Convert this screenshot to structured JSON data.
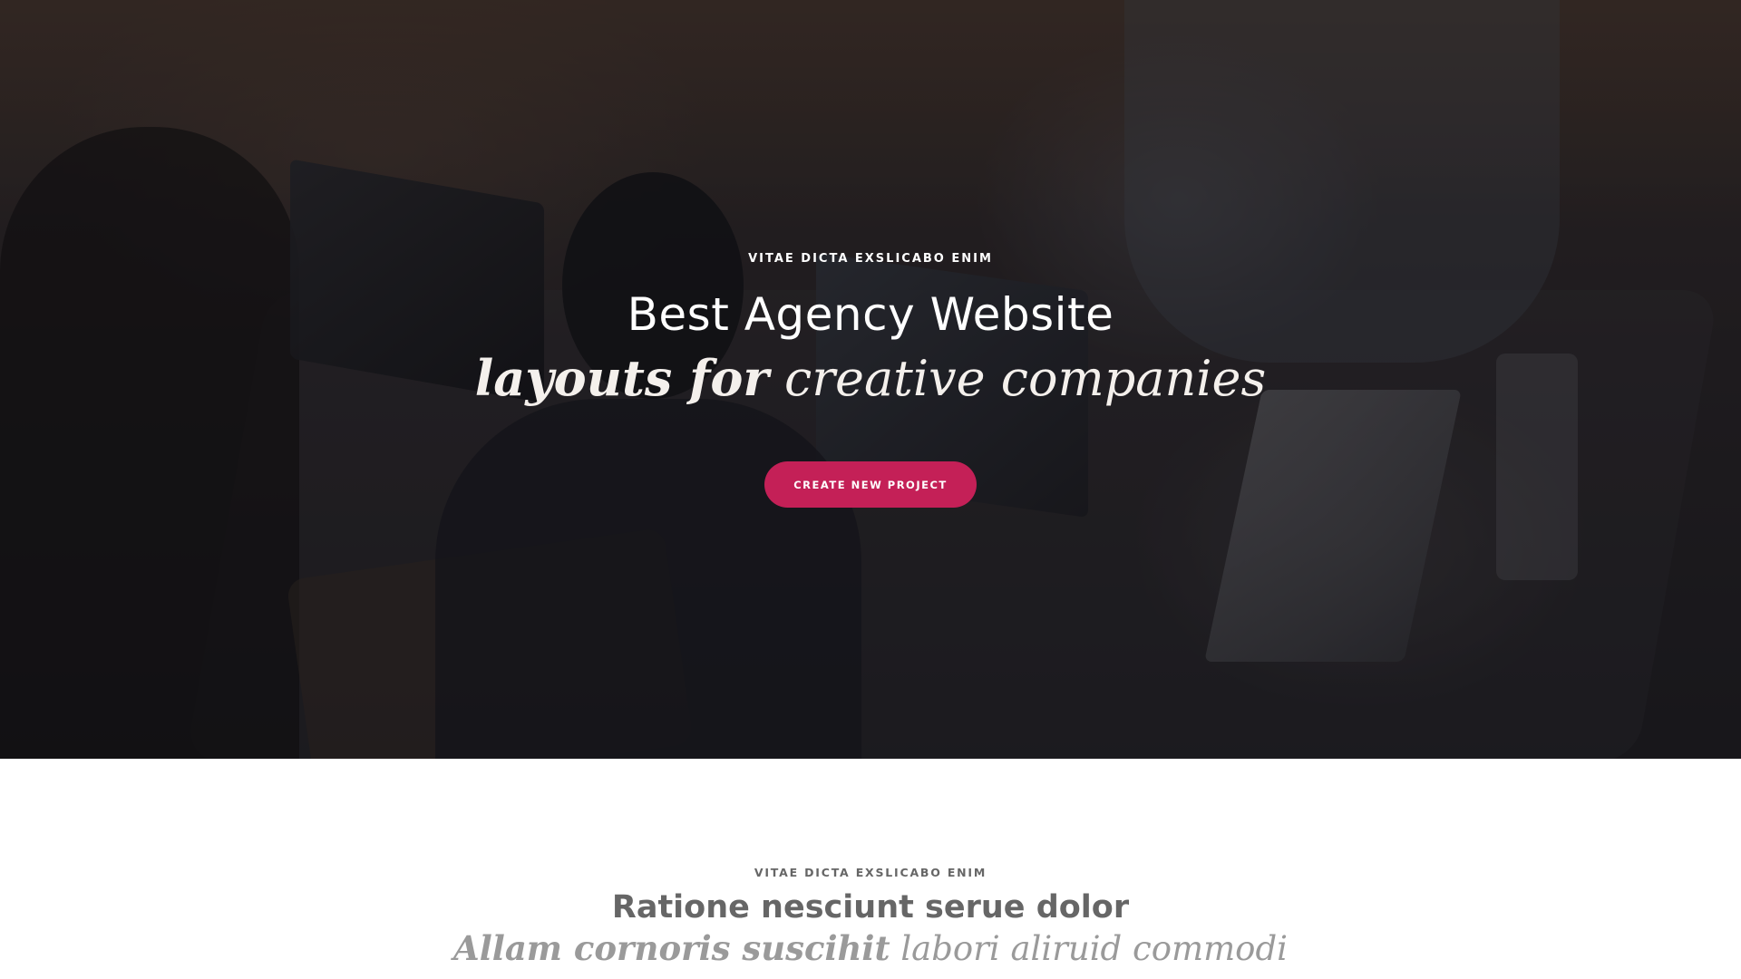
{
  "hero": {
    "eyebrow": "VITAE DICTA EXSLICABO ENIM",
    "title": "Best Agency Website",
    "subtitle_bold": "layouts for",
    "subtitle_regular": "creative companies",
    "cta_label": "CREATE NEW PROJECT",
    "accent_color": "#c42057"
  },
  "section": {
    "eyebrow": "VITAE DICTA EXSLICABO ENIM",
    "title": "Ratione nesciunt serue dolor",
    "subtitle_bold": "Allam cornoris suscihit",
    "subtitle_regular": "labori aliruid commodi"
  }
}
